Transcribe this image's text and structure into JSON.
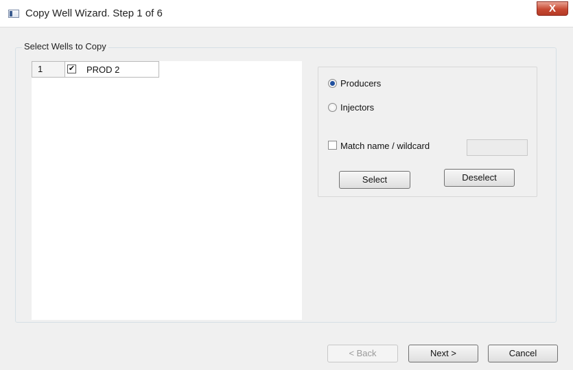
{
  "window": {
    "title": "Copy Well Wizard. Step 1 of 6",
    "close_label": "X"
  },
  "group": {
    "title": "Select Wells to Copy"
  },
  "wells": [
    {
      "number": "1",
      "checked": true,
      "check_mark": "✔",
      "name": "PROD 2"
    }
  ],
  "filters": {
    "producers_label": "Producers",
    "injectors_label": "Injectors",
    "selected": "Producers",
    "match_label": "Match name / wildcard",
    "match_checked": false,
    "wildcard_value": "",
    "select_label": "Select",
    "deselect_label": "Deselect"
  },
  "footer": {
    "back_label": "< Back",
    "next_label": "Next >",
    "cancel_label": "Cancel"
  }
}
